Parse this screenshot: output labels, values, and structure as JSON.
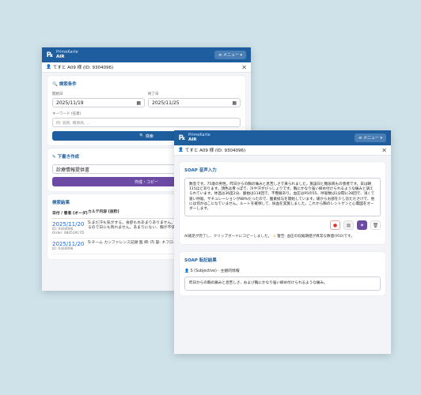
{
  "app": {
    "brand_name": "PrimeKarte",
    "brand_sub": "AIR",
    "menu_label": "≡ メニュー ▾"
  },
  "patient": {
    "label": "てすと A09 様 (ID: 9304096)"
  },
  "search": {
    "title": "検索条件",
    "start_label": "開始日",
    "start_value": "2025/11/19",
    "end_label": "終了日",
    "end_value": "2025/11/25",
    "keyword_label": "キーワード (任意)",
    "keyword_placeholder": "例: 発熱, 糖尿病, ...",
    "search_button": "検索"
  },
  "draft": {
    "title": "下書き作成",
    "document_value": "診療情報提供書",
    "create_button": "作成・コピー"
  },
  "history": {
    "title": "検索結果",
    "header_date": "日付 / 患者 (オーダ)",
    "header_content": "カルテ内容 (抜粋)",
    "rows": [
      {
        "date": "2025/11/20",
        "id": "ID: 9304096",
        "order": "Order: 68453917D",
        "text": "S:まだ汗も気がする。食欲も水あまりありません。あまり夜眠れない。息苦しいです。あるので日にも残れません。あまりにない、胸が不快ないです。何回か"
      },
      {
        "date": "2025/11/20",
        "id": "ID: 9304096",
        "order": "",
        "text": "S:チーム カンファレンス記録 医 師: 内 容: ネフローゼ症候群。データ改善"
      }
    ]
  },
  "soap_voice": {
    "title": "SOAP 音声入力",
    "text": "数急です。75歳の男性。昨日からの胸の痛みと息苦しさで来られました。施設日と糖尿病もの患者です。日は朝115ほどあります。顔色は青っぽで、冷や汗がびっしょりです。胸にかなり強い締め付けられるような痛みと訴えられています。体温は36度2分、脈拍は118回で、不整脈あり。血圧は95の55、呼吸数は1分間に28回で、浅くて速い呼吸。サチュレーションが88%だったので、酸素投与を開始しています。緩からお部を少し診たださけで、他には何かはこになていません。ルートを確保して、採血を実施しました。これから胸のレントゲンと心電図をオーダーします。",
    "status_ok": "AI補足が完了し、クリップボードにコピーしました。",
    "status_warn": "警告: 血圧の収縮期値が異常な数値(950)です。"
  },
  "soap_result": {
    "title": "SOAP 転記結果",
    "subjective_label": "S (Subjective) - 主観的情報",
    "subjective_text": "昨日からの胸の痛みと息苦しさ、および胸にかなり強い締め付けられるような痛み。"
  }
}
